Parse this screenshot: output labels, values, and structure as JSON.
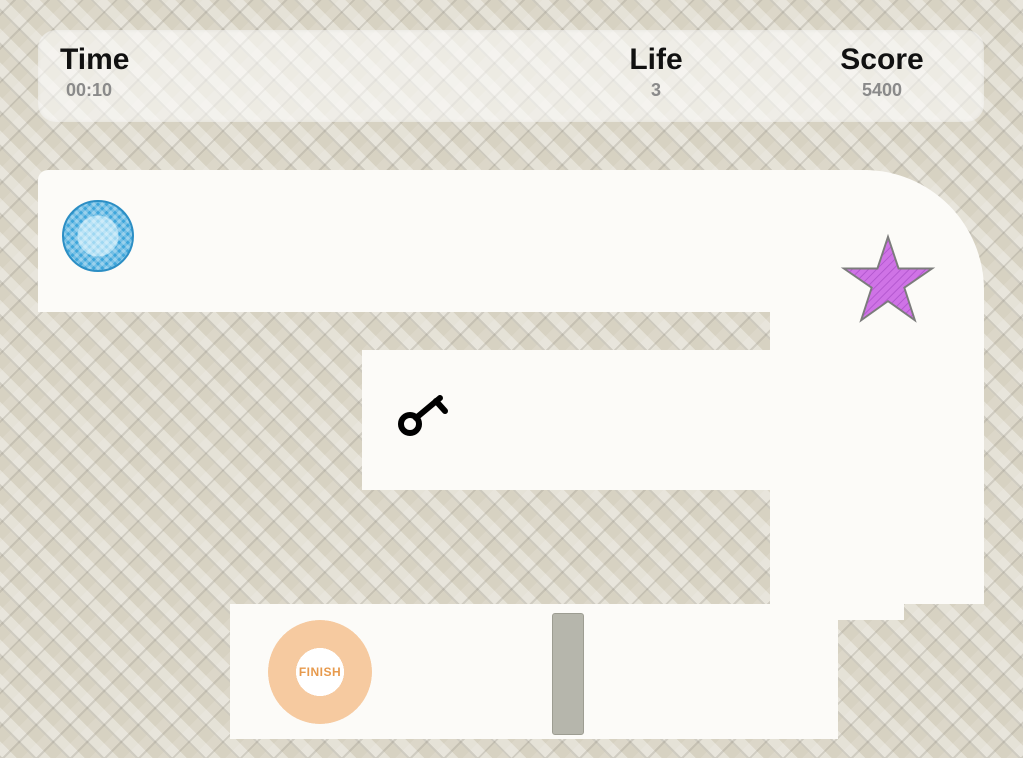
{
  "hud": {
    "time": {
      "label": "Time",
      "value": "00:10"
    },
    "life": {
      "label": "Life",
      "value": "3"
    },
    "score": {
      "label": "Score",
      "value": "5400"
    }
  },
  "finish_label": "FINISH",
  "objects": {
    "ball": "player-ball",
    "key": "key-pickup",
    "star": "star-pickup",
    "finish": "finish-ring",
    "obstacle": "grey-block"
  },
  "colors": {
    "bg": "#d7d2c2",
    "corridor": "#fcfbf8",
    "ball_outer": "#3ea6db",
    "ball_inner": "#9fd8f2",
    "star_fill": "#cf73e6",
    "star_stroke": "#7c7c7c",
    "finish_ring": "#f6caa0",
    "finish_text": "#e79a4d",
    "obstacle": "#b6b6ac"
  }
}
